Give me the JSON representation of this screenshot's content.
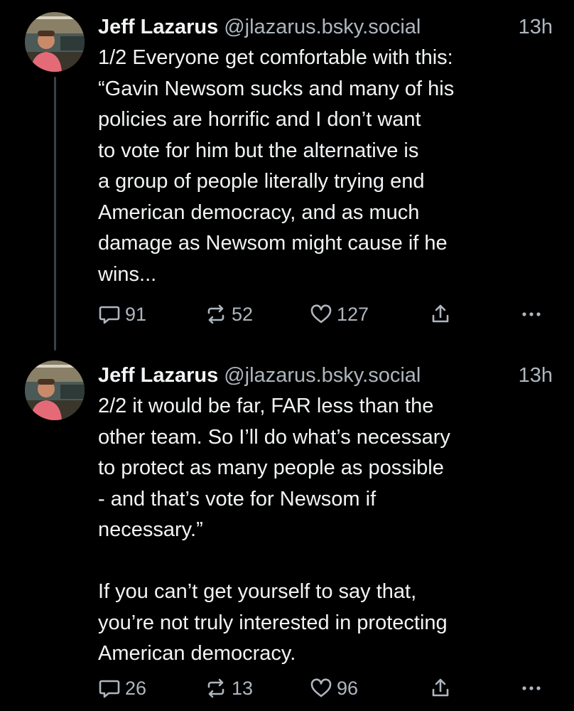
{
  "posts": [
    {
      "author": {
        "name": "Jeff Lazarus",
        "handle": "@jlazarus.bsky.social",
        "avatar_icon": "user-avatar"
      },
      "time": "13h",
      "text_lines": [
        "1/2 Everyone get comfortable with this:",
        "“Gavin Newsom sucks and many of his",
        "policies are horrific and I don’t want",
        "to vote for him but the alternative is",
        "a group of people literally trying end",
        "American democracy, and as much",
        "damage as Newsom might cause if he",
        "wins..."
      ],
      "stats": {
        "replies": "91",
        "reposts": "52",
        "likes": "127"
      }
    },
    {
      "author": {
        "name": "Jeff Lazarus",
        "handle": "@jlazarus.bsky.social",
        "avatar_icon": "user-avatar"
      },
      "time": "13h",
      "text_lines": [
        "2/2 it would be far, FAR less than the",
        "other team. So I’ll do what’s necessary",
        "to protect as many people as possible",
        "- and that’s vote for Newsom if",
        "necessary.”",
        "",
        "If you can’t get yourself to say that,",
        "you’re not truly interested in protecting",
        "American democracy."
      ],
      "stats": {
        "replies": "26",
        "reposts": "13",
        "likes": "96"
      }
    }
  ],
  "icons": {
    "reply": "reply-bubble-icon",
    "repost": "repost-arrows-icon",
    "like": "heart-icon",
    "share": "share-upload-icon",
    "more": "more-dots-icon"
  },
  "colors": {
    "background": "#000000",
    "primary_text": "#f1f3f5",
    "secondary_text": "#aeb6bf",
    "thread_line": "#3a4048"
  }
}
